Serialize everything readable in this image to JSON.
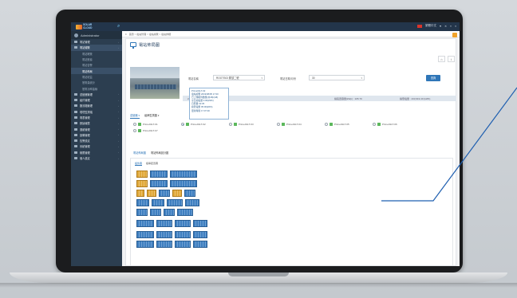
{
  "app": {
    "logo_text": "SOLAR CLOUD",
    "user_label": "Administrator",
    "top_right_label": "繁體中文"
  },
  "breadcrumb": "首頁 > 電站管理 > 電站總覽 > 電站詳細",
  "page_title": "電站佈局圖",
  "sidebar": {
    "items": [
      {
        "label": "電站管理",
        "level": "top",
        "active": false
      },
      {
        "label": "電站總覽",
        "level": "top",
        "active": true
      },
      {
        "label": "電站概覽",
        "level": "sub",
        "active": false
      },
      {
        "label": "電站數據",
        "level": "sub",
        "active": false
      },
      {
        "label": "電站告警",
        "level": "sub",
        "active": false
      },
      {
        "label": "電站佈局",
        "level": "sub",
        "active": true
      },
      {
        "label": "電站收益",
        "level": "sub",
        "active": false
      },
      {
        "label": "發電量統計",
        "level": "sub",
        "active": false
      },
      {
        "label": "發電功率曲線",
        "level": "sub",
        "active": false
      },
      {
        "label": "逆變器管理",
        "level": "top",
        "active": false
      },
      {
        "label": "組件管理",
        "level": "top",
        "active": false
      },
      {
        "label": "匯流箱管理",
        "level": "top",
        "active": false
      },
      {
        "label": "環境監測儀",
        "level": "top",
        "active": false
      },
      {
        "label": "電表管理",
        "level": "top",
        "active": false
      },
      {
        "label": "數據報表",
        "level": "top",
        "active": false
      },
      {
        "label": "運維管理",
        "level": "top",
        "active": false
      },
      {
        "label": "設備管理",
        "level": "top",
        "active": false
      },
      {
        "label": "告警設定",
        "level": "top",
        "active": false
      },
      {
        "label": "系統管理",
        "level": "top",
        "active": false
      },
      {
        "label": "權限管理",
        "level": "top",
        "active": false
      },
      {
        "label": "個人設定",
        "level": "top",
        "active": false
      }
    ]
  },
  "form": {
    "station_label": "電站名稱",
    "station_value": "ROOTS03 屋頂二號",
    "date_label": "電站日期/月份",
    "date_value": "30",
    "query_button": "查詢"
  },
  "dropdown_options": [
    "Prime01LT-02",
    "電站總覽 2019/08/05 17:00",
    "已上傳組件數量(共48)/(48)",
    "全日總電量 0.00(kWh)",
    "日照量 02:35",
    "總發電量 05:00(kWh)",
    "更新時間 17:07:30"
  ],
  "info_strip": {
    "left": "24/08/2019",
    "middle": "總裝置容量(kWp) : 105.70",
    "right": "總發電量 : 433,919.40 (kWh)"
  },
  "inverter_tabs": [
    "逆變器 ▾",
    "組串監測圖 ▾"
  ],
  "inverters_row1": [
    "Prime01LT-01",
    "Prime01LT-02",
    "Prime01LT-03",
    "Prime01LT-04",
    "Prime01LT-05",
    "Prime01LT-06"
  ],
  "inverters_row2": [
    "Prime01LT-07"
  ],
  "selected_inverter_index": 1,
  "section_tabs": [
    "電站佈局圖",
    "電站佈局設計圖"
  ],
  "sub_tabs": [
    "組件圖",
    "組串配置圖"
  ],
  "colors": {
    "sidebar": "#2c3e50",
    "topbar": "#23354a",
    "accent": "#2f76b8",
    "panel_blue": "#3f7fc0",
    "panel_warn": "#e0a93a"
  }
}
